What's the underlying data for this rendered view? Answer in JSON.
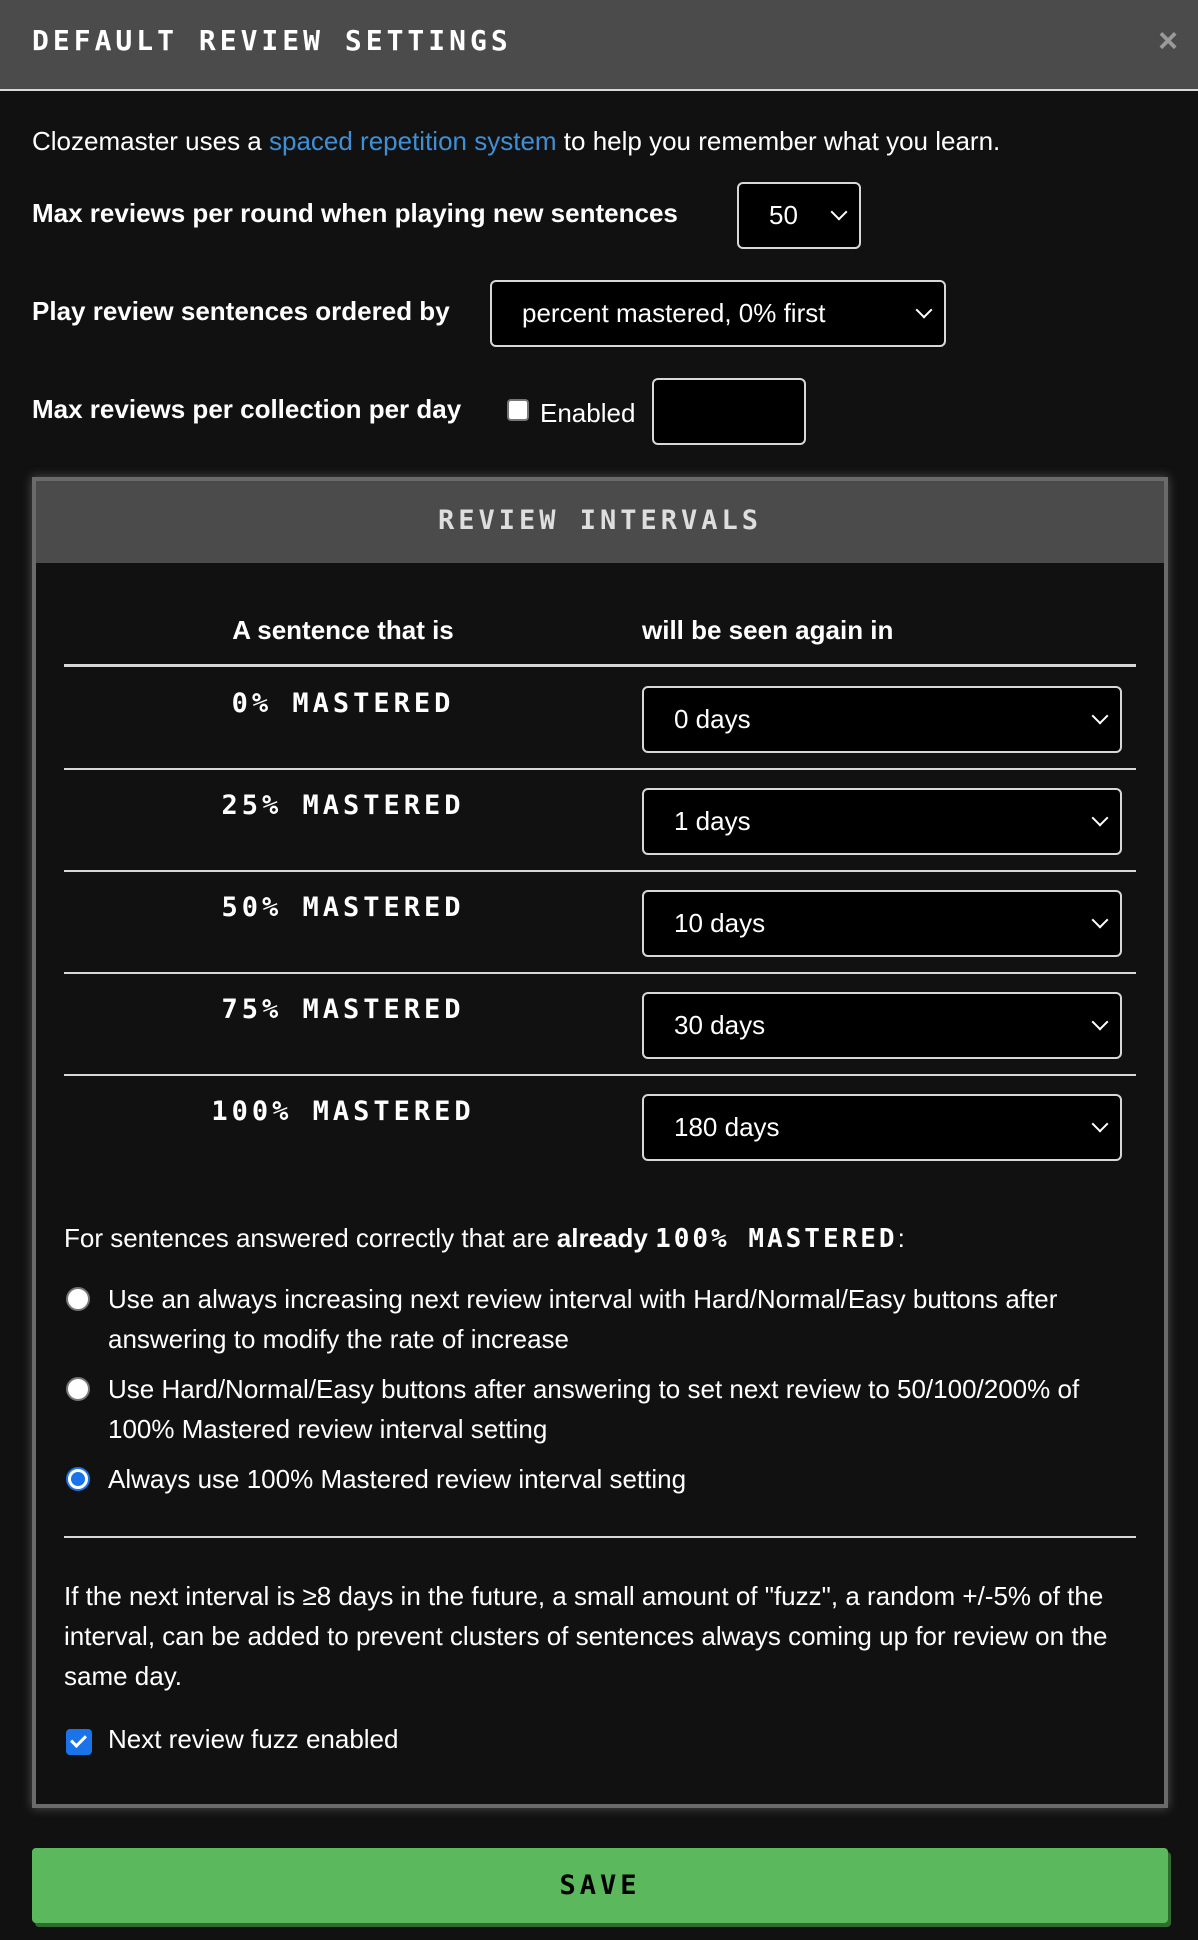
{
  "modal": {
    "title": "DEFAULT REVIEW SETTINGS",
    "close_icon": "×"
  },
  "intro": {
    "before": "Clozemaster uses a ",
    "link": "spaced repetition system",
    "after": " to help you remember what you learn."
  },
  "settings": {
    "max_reviews_label": "Max reviews per round when playing new sentences",
    "max_reviews_value": "50",
    "order_label": "Play review sentences ordered by",
    "order_value": "percent mastered, 0% first",
    "per_day_label": "Max reviews per collection per day",
    "per_day_enabled_label": "Enabled",
    "per_day_enabled": false,
    "per_day_value": ""
  },
  "intervals": {
    "title": "REVIEW INTERVALS",
    "col_sentence": "A sentence that is",
    "col_seen_again": "will be seen again in",
    "rows": [
      {
        "label": "0% MASTERED",
        "value": "0 days"
      },
      {
        "label": "25% MASTERED",
        "value": "1 days"
      },
      {
        "label": "50% MASTERED",
        "value": "10 days"
      },
      {
        "label": "75% MASTERED",
        "value": "30 days"
      },
      {
        "label": "100% MASTERED",
        "value": "180 days"
      }
    ],
    "mastered_intro_before": "For sentences answered correctly that are ",
    "mastered_intro_bold": "already ",
    "mastered_intro_pixel": "100% MASTERED",
    "mastered_intro_after": ":",
    "options": [
      {
        "label": "Use an always increasing next review interval with Hard/Normal/Easy buttons after answering to modify the rate of increase",
        "selected": false
      },
      {
        "label": "Use Hard/Normal/Easy buttons after answering to set next review to 50/100/200% of 100% Mastered review interval setting",
        "selected": false
      },
      {
        "label": "Always use 100% Mastered review interval setting",
        "selected": true
      }
    ],
    "fuzz_text": "If the next interval is ≥8 days in the future, a small amount of \"fuzz\", a random +/-5% of the interval, can be added to prevent clusters of sentences always coming up for review on the same day.",
    "fuzz_label": "Next review fuzz enabled",
    "fuzz_enabled": true
  },
  "save_label": "SAVE"
}
